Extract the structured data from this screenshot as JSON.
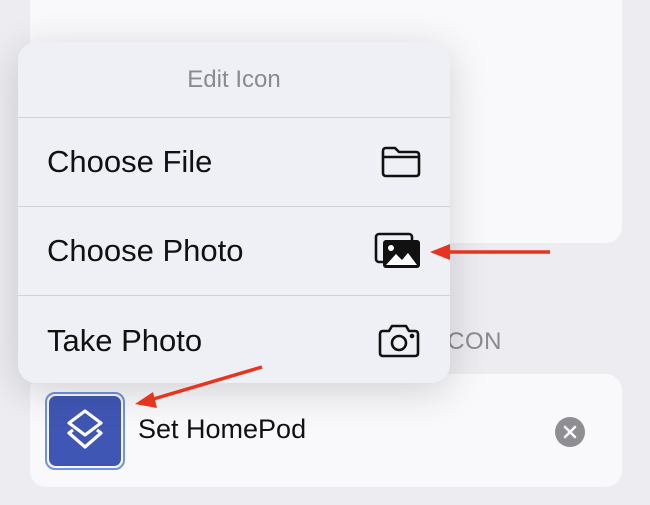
{
  "background_section": {
    "label": "ICON"
  },
  "menu": {
    "title": "Edit Icon",
    "items": [
      {
        "label": "Choose File",
        "icon": "folder-icon"
      },
      {
        "label": "Choose Photo",
        "icon": "photos-icon"
      },
      {
        "label": "Take Photo",
        "icon": "camera-icon"
      }
    ]
  },
  "shortcut_row": {
    "title": "Set HomePod",
    "icon": "shortcuts-icon",
    "icon_color": "#3f56b4",
    "clear_icon": "clear-icon"
  },
  "annotations": {
    "arrow_color": "#e8341c"
  }
}
